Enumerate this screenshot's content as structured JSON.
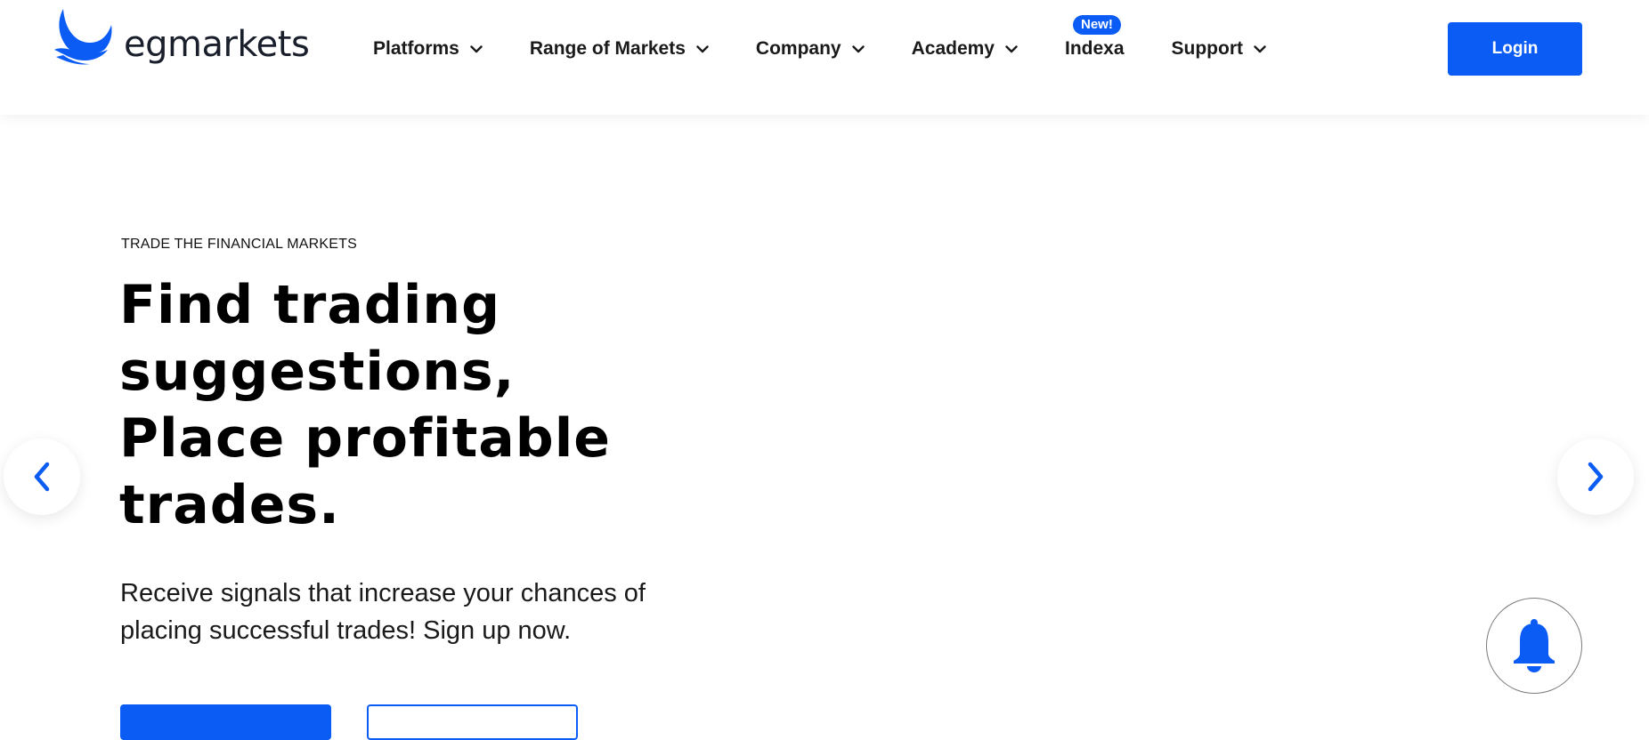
{
  "brand": {
    "name": "egmarkets",
    "accent_color": "#0a5cf5"
  },
  "nav": {
    "items": [
      {
        "label": "Platforms",
        "has_dropdown": true,
        "icon": "chevron-down-icon"
      },
      {
        "label": "Range of Markets",
        "has_dropdown": true,
        "icon": "chevron-down-icon"
      },
      {
        "label": "Company",
        "has_dropdown": true,
        "icon": "chevron-down-icon"
      },
      {
        "label": "Academy",
        "has_dropdown": true,
        "icon": "chevron-down-icon"
      },
      {
        "label": "Indexa",
        "has_dropdown": false,
        "badge": "New!"
      },
      {
        "label": "Support",
        "has_dropdown": true,
        "icon": "chevron-down-icon"
      }
    ],
    "login_label": "Login"
  },
  "hero": {
    "eyebrow": "TRADE THE FINANCIAL MARKETS",
    "headline_lines": [
      "Find trading",
      "suggestions,",
      "Place profitable",
      "trades."
    ],
    "subtext_lines": [
      "Receive signals that increase your chances of",
      "placing successful trades! Sign up now."
    ]
  },
  "carousel": {
    "prev_icon": "chevron-left-icon",
    "next_icon": "chevron-right-icon"
  },
  "notification": {
    "icon": "bell-icon"
  }
}
